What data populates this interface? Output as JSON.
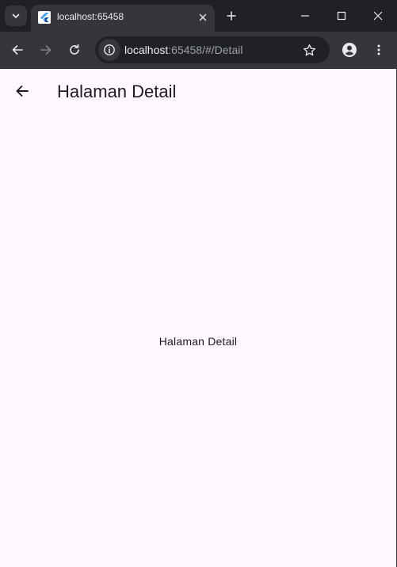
{
  "browser": {
    "tab": {
      "title": "localhost:65458",
      "favicon": "flutter-logo-icon"
    },
    "window_controls": [
      "minimize-icon",
      "maximize-icon",
      "close-icon"
    ],
    "toolbar": {
      "back": "arrow-left-icon",
      "forward": "arrow-right-icon",
      "reload": "reload-icon",
      "profile": "profile-icon",
      "menu": "kebab-menu-icon"
    },
    "omnibox": {
      "host": "localhost",
      "path": ":65458/#/Detail",
      "site_info_icon": "info-icon",
      "bookmark_icon": "star-icon"
    }
  },
  "app": {
    "appbar": {
      "title": "Halaman Detail",
      "back_icon": "arrow-left-icon"
    },
    "body": {
      "text": "Halaman Detail"
    }
  },
  "colors": {
    "chrome_dark": "#202124",
    "chrome_mid": "#35363a",
    "page_background": "#fdf7ff",
    "text_primary": "#1d1b20"
  }
}
